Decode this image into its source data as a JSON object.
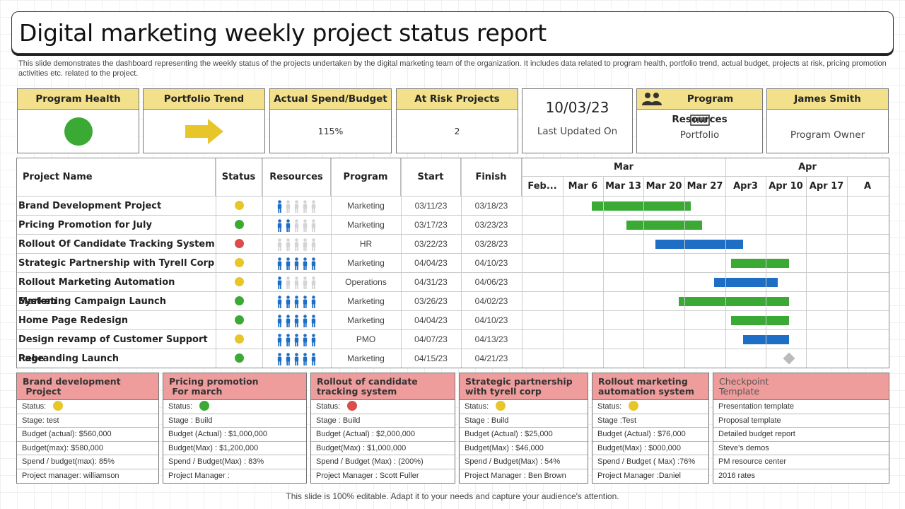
{
  "title": "Digital marketing weekly project status report",
  "description": "This slide demonstrates the dashboard representing the weekly status of the projects undertaken by the digital marketing team of the organization. It includes data related to program health, portfolio trend, actual budget, projects at risk, pricing promotion activities etc. related to the project.",
  "colors": {
    "green": "#3aaa35",
    "yellow": "#e8c62a",
    "red": "#dd4b4b",
    "blue": "#1f6ec6",
    "header_yellow": "#f2e08a",
    "header_pink": "#ef9c9c"
  },
  "cards": {
    "program_health": {
      "label": "Program Health",
      "status": "green"
    },
    "portfolio_trend": {
      "label": "Portfolio Trend",
      "icon": "right-arrow-icon"
    },
    "actual_spend": {
      "label": "Actual Spend/Budget",
      "value": "115%"
    },
    "at_risk": {
      "label": "At Risk Projects",
      "value": "2"
    },
    "date": {
      "value": "10/03/23",
      "label": "Last Updated On"
    },
    "resources": {
      "label": "Program Resources",
      "value": "Portfolio",
      "icon": "people-icon"
    },
    "owner": {
      "label": "James Smith",
      "value": "Program Owner"
    }
  },
  "table": {
    "headers": {
      "name": "Project Name",
      "status": "Status",
      "resources": "Resources",
      "program": "Program",
      "start": "Start",
      "finish": "Finish"
    },
    "months": [
      {
        "label": "Mar"
      },
      {
        "label": "Apr"
      }
    ],
    "weeks": [
      "Feb...",
      "Mar 6",
      "Mar 13",
      "Mar 20",
      "Mar 27",
      "Apr3",
      "Apr 10",
      "Apr 17",
      "A"
    ],
    "rows": [
      {
        "name": "Brand Development Project",
        "status": "yellow",
        "resources": 1,
        "program": "Marketing",
        "start": "03/11/23",
        "finish": "03/18/23",
        "bar_start": "03/11/23",
        "bar_end": "03/28/23",
        "bar_color": "green"
      },
      {
        "name": "Pricing Promotion for July",
        "status": "green",
        "resources": 2,
        "program": "Marketing",
        "start": "03/17/23",
        "finish": "03/23/23",
        "bar_start": "03/17/23",
        "bar_end": "03/30/23",
        "bar_color": "green"
      },
      {
        "name": "Rollout Of Candidate Tracking System",
        "status": "red",
        "resources": 0,
        "program": "HR",
        "start": "03/22/23",
        "finish": "03/28/23",
        "bar_start": "03/22/23",
        "bar_end": "04/06/23",
        "bar_color": "blue"
      },
      {
        "name": "Strategic Partnership with Tyrell Corp",
        "status": "yellow",
        "resources": 5,
        "program": "Marketing",
        "start": "04/04/23",
        "finish": "04/10/23",
        "bar_start": "04/04/23",
        "bar_end": "04/14/23",
        "bar_color": "green"
      },
      {
        "name": "Rollout Marketing Automation System",
        "status": "yellow",
        "resources": 1,
        "program": "Operations",
        "start": "04/31/23",
        "finish": "04/06/23",
        "bar_start": "04/01/23",
        "bar_end": "04/12/23",
        "bar_color": "blue"
      },
      {
        "name": "Marketing Campaign Launch",
        "status": "green",
        "resources": 5,
        "program": "Marketing",
        "start": "03/26/23",
        "finish": "04/02/23",
        "bar_start": "03/26/23",
        "bar_end": "04/14/23",
        "bar_color": "green"
      },
      {
        "name": "Home Page Redesign",
        "status": "green",
        "resources": 5,
        "program": "Marketing",
        "start": "04/04/23",
        "finish": "04/10/23",
        "bar_start": "04/04/23",
        "bar_end": "04/14/23",
        "bar_color": "green"
      },
      {
        "name": "Design revamp of Customer Support Page",
        "status": "yellow",
        "resources": 5,
        "program": "PMO",
        "start": "04/07/23",
        "finish": "04/13/23",
        "bar_start": "04/06/23",
        "bar_end": "04/14/23",
        "bar_color": "blue"
      },
      {
        "name": "Rebranding Launch",
        "status": "green",
        "resources": 5,
        "program": "Marketing",
        "start": "04/15/23",
        "finish": "04/21/23",
        "milestone": "04/14/23"
      }
    ]
  },
  "panels": [
    {
      "title": "Brand development\n Project",
      "status_label": "Status:",
      "status": "yellow",
      "rows": [
        "Stage: test",
        "Budget (actual): $560,000",
        "Budget(max): $580,000",
        "Spend / budget(max): 85%",
        "Project manager:  williamson"
      ]
    },
    {
      "title": "Pricing promotion\n For march",
      "status_label": "Status:",
      "status": "green",
      "rows": [
        "Stage : Build",
        "Budget (Actual) : $1,000,000",
        "Budget(Max) : $1,200,000",
        "Spend / Budget(Max) : 83%",
        "Project Manager :"
      ]
    },
    {
      "title": "Rollout of candidate tracking system",
      "status_label": "Status:",
      "status": "red",
      "rows": [
        "Stage : Build",
        "Budget (Actual) : $2,000,000",
        "Budget(Max) : $1,000,000",
        "Spend / Budget (Max) : (200%)",
        "Project Manager  : Scott Fuller"
      ]
    },
    {
      "title": "Strategic partnership with tyrell corp",
      "status_label": "Status:",
      "status": "yellow",
      "rows": [
        "Stage : Build",
        "Budget (Actual) : $25,000",
        "Budget(Max) : $46,000",
        "Spend / Budget(Max) : 54%",
        "Project Manager  : Ben Brown"
      ]
    },
    {
      "title": "Rollout marketing automation system",
      "status_label": "Status:",
      "status": "yellow",
      "rows": [
        "Stage :Test",
        "Budget (Actual) : $76,000",
        "Budget(Max) : $000,000",
        "Spend / Budget ( Max) :76%",
        "Project Manager :Daniel"
      ]
    },
    {
      "title": "Checkpoint\nTemplate",
      "checkpoint": true,
      "rows": [
        "Presentation template",
        "Proposal template",
        "Detailed budget report",
        "Steve's demos",
        "PM  resource center",
        "2016 rates"
      ]
    }
  ],
  "footer": "This slide is 100% editable. Adapt it to your needs and capture your audience's attention."
}
